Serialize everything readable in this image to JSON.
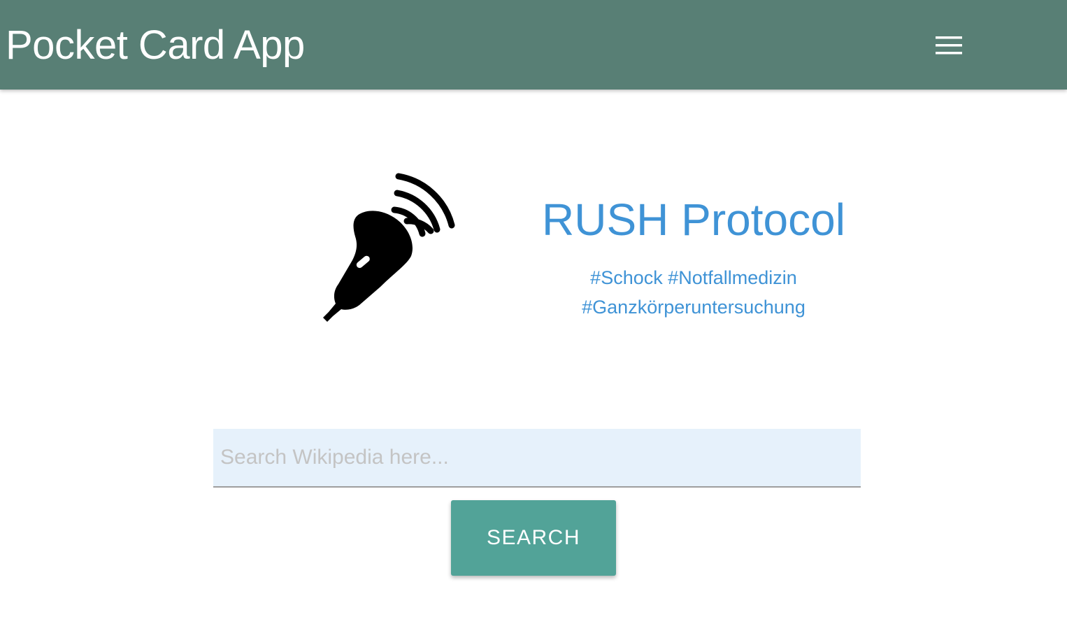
{
  "header": {
    "brand": "Pocket Card App",
    "menu_icon": "hamburger-menu-icon",
    "background_color": "#587f75"
  },
  "hero": {
    "icon": "ultrasound-probe-icon",
    "title": "RUSH Protocol",
    "tags": [
      "#Schock #Notfallmedizin",
      "#Ganzkörperuntersuchung"
    ],
    "accent_color": "#3f93d6"
  },
  "search": {
    "placeholder": "Search Wikipedia here...",
    "value": "",
    "button_label": "SEARCH",
    "button_color": "#52a398"
  }
}
